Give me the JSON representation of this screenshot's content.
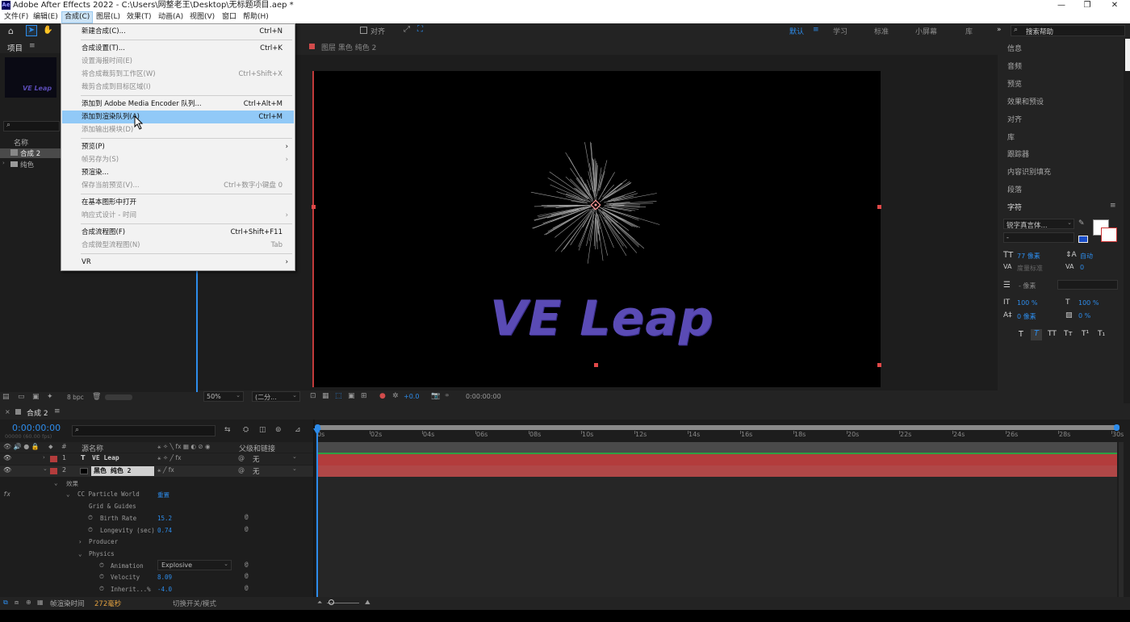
{
  "window": {
    "title": "Adobe After Effects 2022 - C:\\Users\\网整老王\\Desktop\\无标题项目.aep *",
    "logo": "Ae",
    "min": "—",
    "max": "❐",
    "close": "✕"
  },
  "menubar": [
    "文件(F)",
    "编辑(E)",
    "合成(C)",
    "图层(L)",
    "效果(T)",
    "动画(A)",
    "视图(V)",
    "窗口",
    "帮助(H)"
  ],
  "toolbar": {
    "align": "对齐",
    "workspaces": [
      "默认",
      "学习",
      "标准",
      "小屏幕",
      "库"
    ],
    "ws_menu": "≡",
    "more": "»",
    "search_placeholder": "搜索帮助"
  },
  "menu": {
    "items": [
      {
        "label": "新建合成(C)...",
        "shortcut": "Ctrl+N",
        "disabled": false
      },
      {
        "label": "合成设置(T)...",
        "shortcut": "Ctrl+K",
        "disabled": false
      },
      {
        "label": "设置海报时间(E)",
        "shortcut": "",
        "disabled": true
      },
      {
        "label": "将合成裁剪到工作区(W)",
        "shortcut": "Ctrl+Shift+X",
        "disabled": true
      },
      {
        "label": "裁剪合成到目标区域(I)",
        "shortcut": "",
        "disabled": true
      },
      {
        "label": "添加到 Adobe Media Encoder 队列...",
        "shortcut": "Ctrl+Alt+M",
        "disabled": false
      },
      {
        "label": "添加到渲染队列(A)",
        "shortcut": "Ctrl+M",
        "disabled": false,
        "highlight": true
      },
      {
        "label": "添加输出模块(D)",
        "shortcut": "",
        "disabled": true
      },
      {
        "label": "预览(P)",
        "shortcut": "",
        "arrow": true,
        "disabled": false
      },
      {
        "label": "帧另存为(S)",
        "shortcut": "",
        "arrow": true,
        "disabled": true
      },
      {
        "label": "预渲染...",
        "shortcut": "",
        "disabled": false
      },
      {
        "label": "保存当前预览(V)...",
        "shortcut": "Ctrl+数字小键盘 0",
        "disabled": true
      },
      {
        "label": "在基本图形中打开",
        "shortcut": "",
        "disabled": false
      },
      {
        "label": "响应式设计 - 时间",
        "shortcut": "",
        "arrow": true,
        "disabled": true
      },
      {
        "label": "合成流程图(F)",
        "shortcut": "Ctrl+Shift+F11",
        "disabled": false
      },
      {
        "label": "合成微型流程图(N)",
        "shortcut": "Tab",
        "disabled": true
      },
      {
        "label": "VR",
        "shortcut": "",
        "arrow": true,
        "disabled": false
      }
    ]
  },
  "project": {
    "tab": "项目",
    "menu": "≡",
    "thumb_text": "VE Leap",
    "col_name": "名称",
    "items": [
      "合成 2",
      "纯色"
    ],
    "bpc": "8 bpc"
  },
  "viewer": {
    "tab_label": "图层 黑色 纯色 2",
    "title_text": "VE Leap",
    "zoom": "50%",
    "resolution": "(二分...",
    "exposure": "+0.0",
    "timecode": "0:00:00:00"
  },
  "right_panel": {
    "items": [
      "信息",
      "音频",
      "预览",
      "效果和预设",
      "对齐",
      "库",
      "跟踪器",
      "内容识别填充",
      "段落",
      "字符"
    ],
    "char": {
      "font": "锐字真言体...",
      "style": "-",
      "size": "77 像素",
      "leading": "自动",
      "kerning": "度量标准",
      "tracking": "0",
      "stroke": "- 像素",
      "vscale": "100 %",
      "hscale": "100 %",
      "baseline": "0 像素",
      "tsume": "0 %",
      "styles": [
        "T",
        "T",
        "TT",
        "Tт",
        "T¹",
        "T₁"
      ]
    }
  },
  "timeline": {
    "tab": "合成 2",
    "menu": "≡",
    "timecode": "0:00:00:00",
    "frames": "00000 (60.00 fps)",
    "cols": {
      "source": "源名称",
      "parent": "父级和链接"
    },
    "ticks": [
      "0s",
      "02s",
      "04s",
      "06s",
      "08s",
      "10s",
      "12s",
      "14s",
      "16s",
      "18s",
      "20s",
      "22s",
      "24s",
      "26s",
      "28s",
      "30s"
    ],
    "layers": [
      {
        "num": "1",
        "type": "T",
        "name": "VE Leap",
        "parent": "无"
      },
      {
        "num": "2",
        "type": "",
        "name": "黑色 纯色 2",
        "parent": "无"
      }
    ],
    "props": {
      "effects": "效果",
      "effect_name": "CC Particle World",
      "reset": "重置",
      "grid": "Grid & Guides",
      "birth_rate": "Birth Rate",
      "birth_rate_v": "15.2",
      "longevity": "Longevity (sec)",
      "longevity_v": "0.74",
      "producer": "Producer",
      "physics": "Physics",
      "animation": "Animation",
      "animation_v": "Explosive",
      "velocity": "Velocity",
      "velocity_v": "8.09",
      "inherit": "Inherit...%",
      "inherit_v": "-4.0"
    },
    "footer": {
      "render_label": "帧渲染时间",
      "render_val": "272毫秒",
      "toggle": "切换开关/模式"
    }
  },
  "colors": {
    "accent": "#2d8ceb",
    "layer_red": "#b33c3c",
    "text_purple": "#5a4bb5"
  }
}
